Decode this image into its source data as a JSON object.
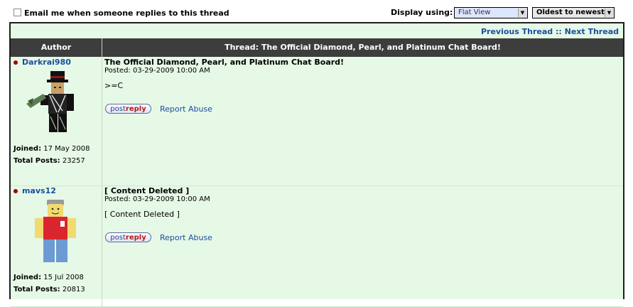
{
  "topbar": {
    "email_label": "Email me when someone replies to this thread",
    "display_label": "Display using:",
    "view_select": "Flat View",
    "order_select": "Oldest to newest"
  },
  "nav": {
    "previous": "Previous Thread",
    "separator": "::",
    "next": "Next Thread"
  },
  "table": {
    "author_header": "Author",
    "thread_header": "Thread: The Official Diamond, Pearl, and Platinum Chat Board!"
  },
  "posts": [
    {
      "username": "Darkrai980",
      "joined_label": "Joined:",
      "joined": "17 May 2008",
      "total_label": "Total Posts:",
      "total": "23257",
      "title": "The Official Diamond, Pearl, and Platinum Chat Board!",
      "posted": "Posted: 03-29-2009 10:00 AM",
      "body": ">=C",
      "reply_post": "post",
      "reply_reply": "reply",
      "report": "Report Abuse"
    },
    {
      "username": "mavs12",
      "joined_label": "Joined:",
      "joined": "15 Jul 2008",
      "total_label": "Total Posts:",
      "total": "20813",
      "title": "[ Content Deleted ]",
      "posted": "Posted: 03-29-2009 10:00 AM",
      "body": "[ Content Deleted ]",
      "reply_post": "post",
      "reply_reply": "reply",
      "report": "Report Abuse"
    }
  ],
  "colors": {
    "frame_bg": "#e6f8e6",
    "header_bg": "#3d3d3d",
    "link": "#1a4fa0",
    "online_dot": "#a30000"
  }
}
